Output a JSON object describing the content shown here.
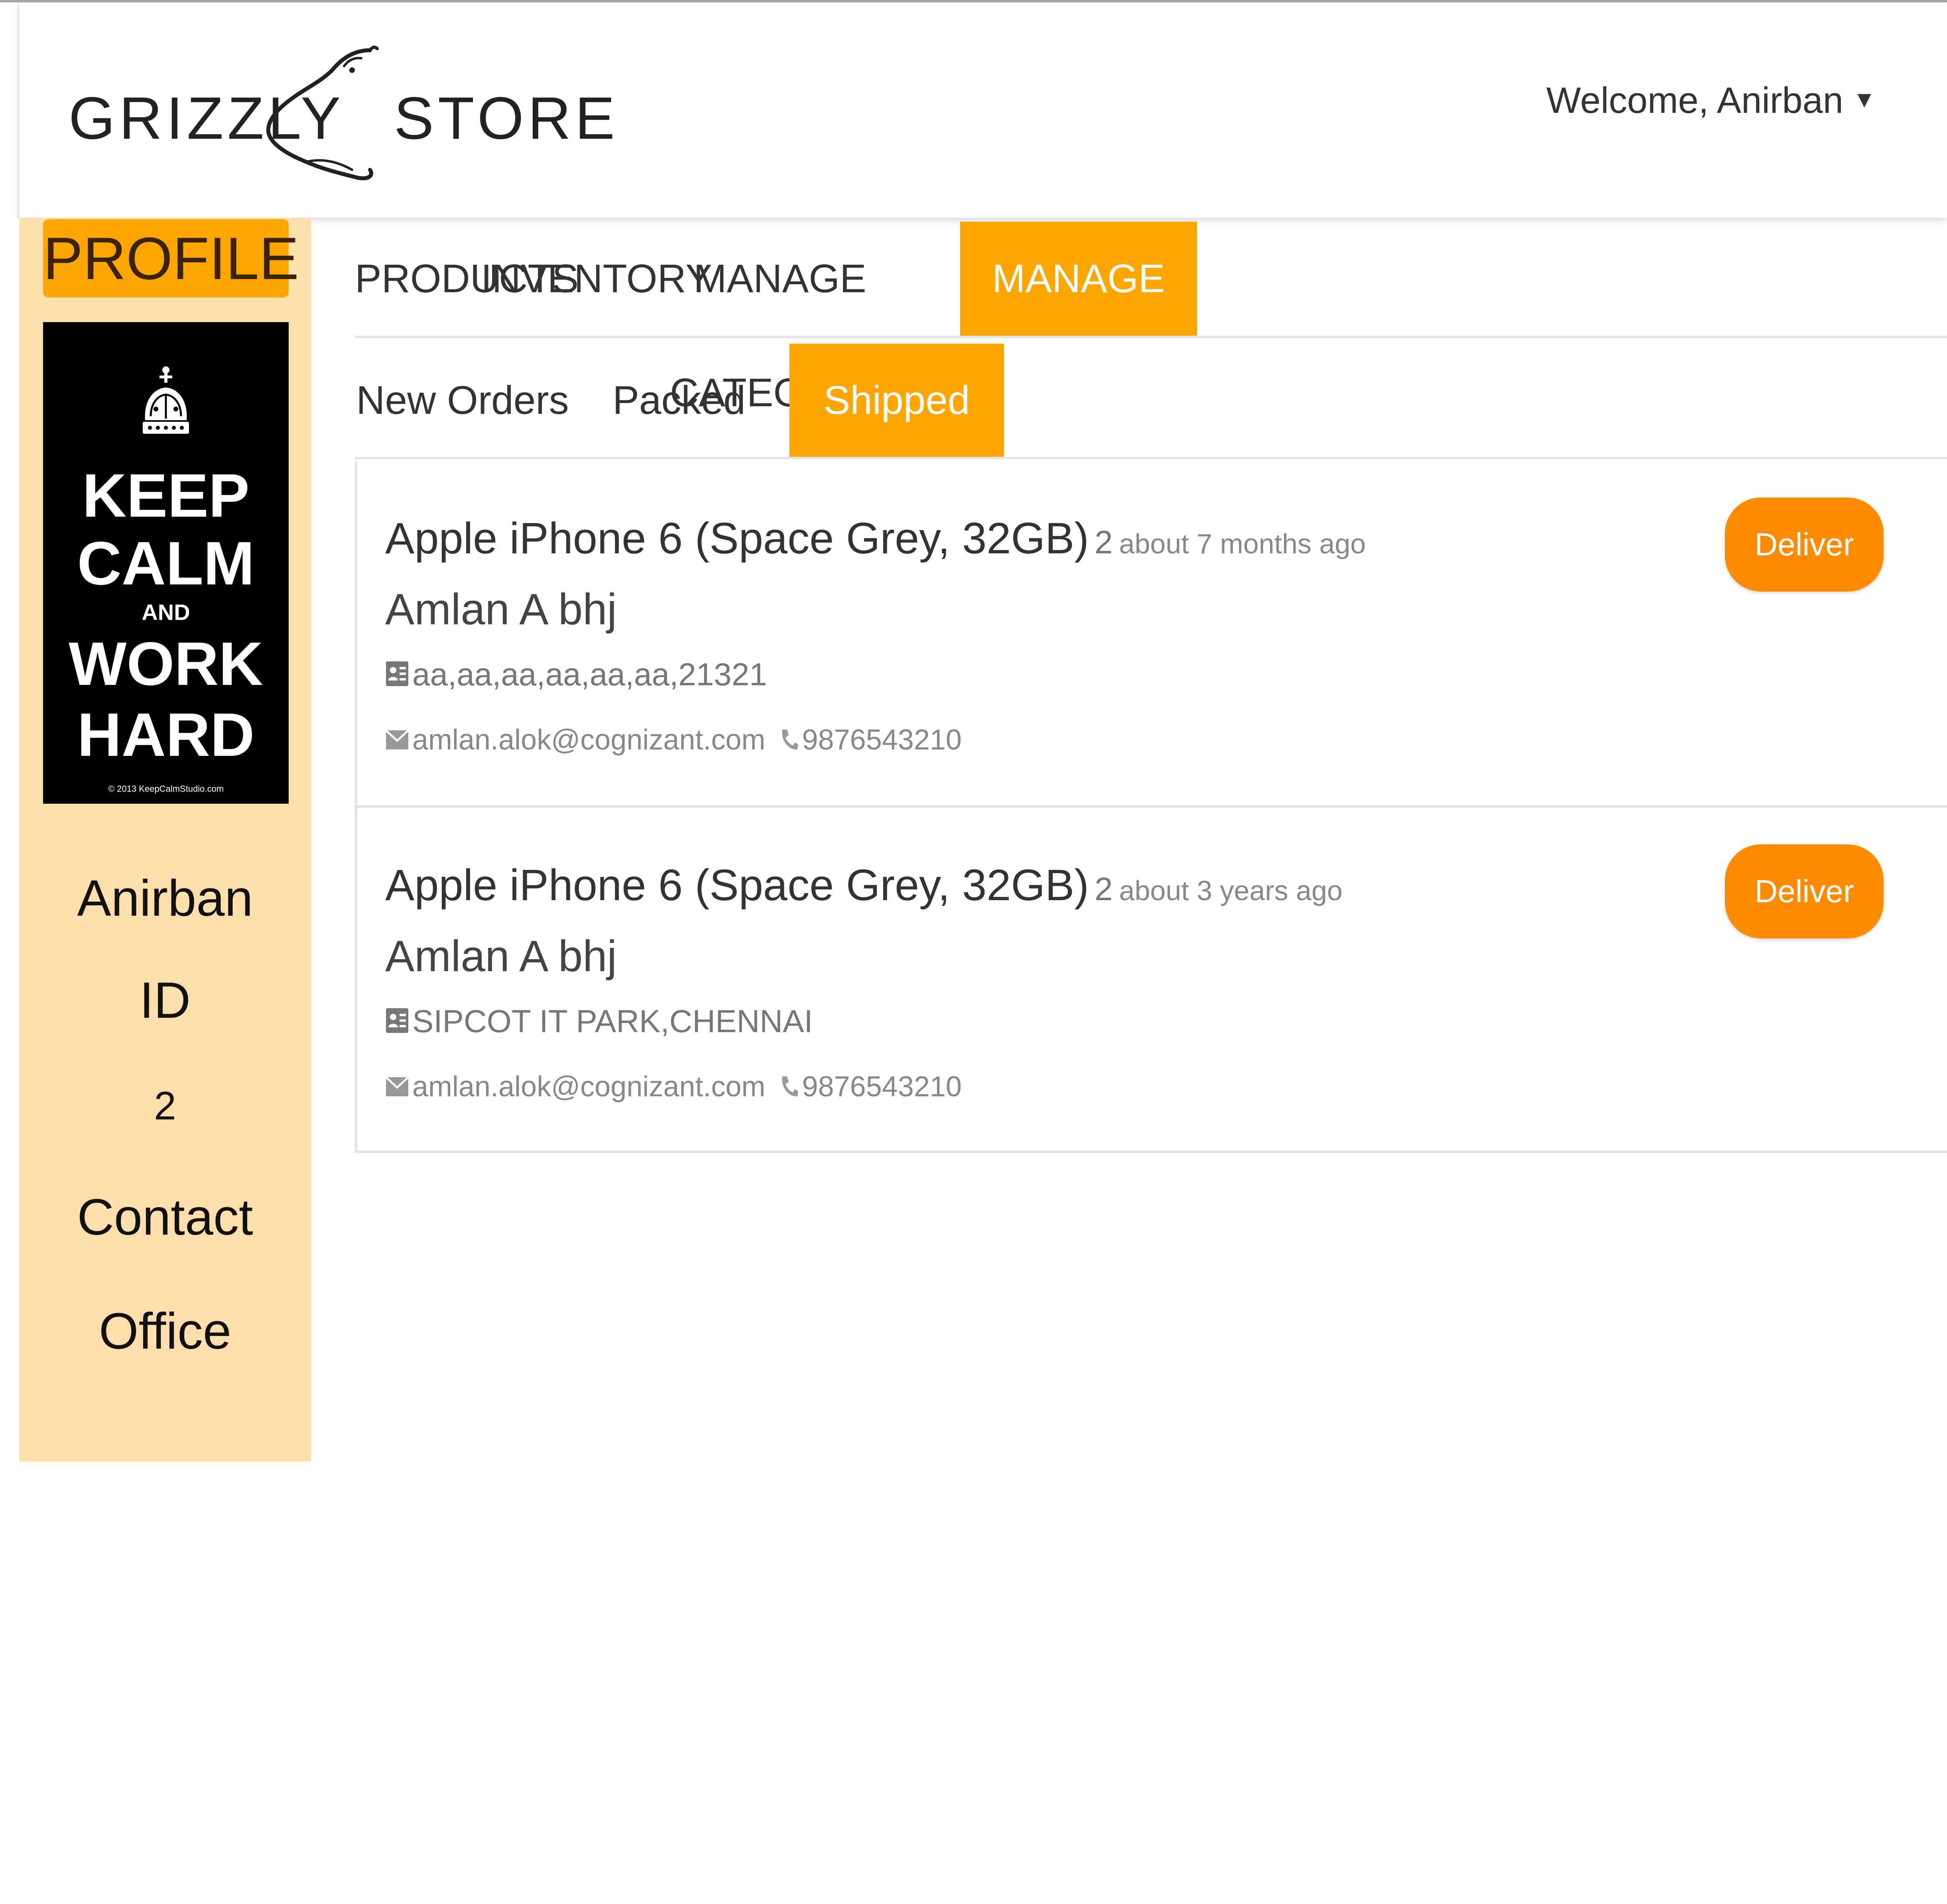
{
  "header": {
    "brand_left": "GRIZZLY",
    "brand_right": "STORE",
    "logo_icon": "bear-head-icon",
    "welcome": "Welcome, Anirban",
    "welcome_caret": "▼"
  },
  "sidebar": {
    "profile_label": "PROFILE",
    "poster": {
      "line1": "KEEP",
      "line2": "CALM",
      "line3": "AND",
      "line4": "WORK",
      "line5": "HARD",
      "copyright": "© 2013 KeepCalmStudio.com"
    },
    "name": "Anirban",
    "id_label": "ID",
    "id_value": "2",
    "contact_label": "Contact",
    "office_label": "Office"
  },
  "nav": {
    "tabs": [
      {
        "label": "PRODUCTS"
      },
      {
        "label": "INVENTORY"
      },
      {
        "label": "MANAGE CATEGORY"
      },
      {
        "label": "MANAGE ORDERS",
        "active": true
      }
    ]
  },
  "subnav": {
    "tabs": [
      {
        "label": "New Orders"
      },
      {
        "label": "Packed"
      },
      {
        "label": "Shipped",
        "active": true
      }
    ]
  },
  "orders": [
    {
      "product": "Apple iPhone 6 (Space Grey, 32GB)",
      "quantity": "2",
      "ago": "about 7 months ago",
      "customer": "Amlan A bhj",
      "address": "aa,aa,aa,aa,aa,aa,21321",
      "email": "amlan.alok@cognizant.com",
      "phone": "9876543210",
      "action": "Deliver item"
    },
    {
      "product": "Apple iPhone 6 (Space Grey, 32GB)",
      "quantity": "2",
      "ago": "about 3 years ago",
      "customer": "Amlan A bhj",
      "address": "SIPCOT IT PARK,CHENNAI",
      "email": "amlan.alok@cognizant.com",
      "phone": "9876543210",
      "action": "Deliver item"
    }
  ],
  "colors": {
    "accent": "#ffa500",
    "button": "#ff8c00",
    "sidebar_bg": "#ffdeae"
  }
}
